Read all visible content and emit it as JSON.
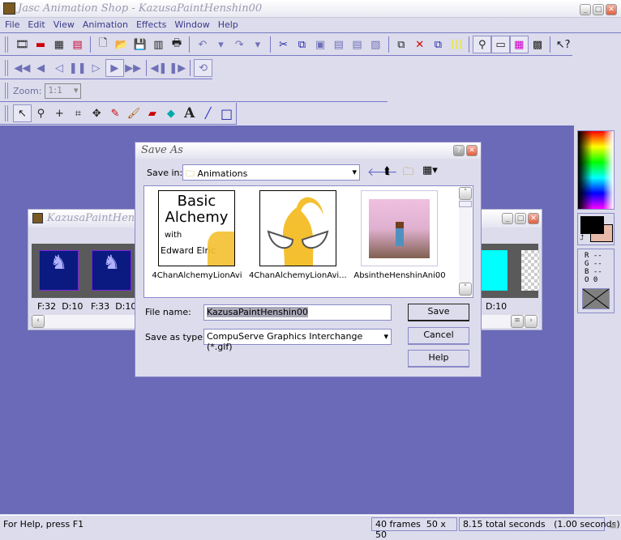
{
  "app": {
    "title": "Jasc Animation Shop - KazusaPaintHenshin00"
  },
  "menu": [
    "File",
    "Edit",
    "View",
    "Animation",
    "Effects",
    "Window",
    "Help"
  ],
  "toolbar": {
    "zoom_label": "Zoom:",
    "zoom_value": "1:1"
  },
  "icons": {
    "standard": [
      "animation-wizard-icon",
      "banner-wizard-icon",
      "optimization-wizard-icon",
      "export-icon",
      "new-icon",
      "open-icon",
      "save-icon",
      "save-frames-icon",
      "print-icon",
      "undo-icon",
      "undo-dropdown-icon",
      "redo-icon",
      "redo-dropdown-icon",
      "cut-icon",
      "copy-icon",
      "paste-new-icon",
      "paste-after-icon",
      "paste-before-icon",
      "paste-into-icon",
      "duplicate-icon",
      "delete-frames-icon",
      "copy-frames-icon",
      "transitions-icon",
      "preview-icon",
      "properties-icon",
      "palette-icon",
      "film-strip-icon",
      "context-help-icon"
    ],
    "vcr": [
      "first-frame-icon",
      "prev-frame-icon",
      "prev-icon",
      "pause-icon",
      "next-icon",
      "play-icon",
      "last-frame-icon",
      "step-back-icon",
      "step-forward-icon",
      "loop-icon"
    ],
    "tools": [
      "arrow-tool-icon",
      "zoom-tool-icon",
      "crosshair-tool-icon",
      "crop-tool-icon",
      "move-tool-icon",
      "dropper-tool-icon",
      "brush-tool-icon",
      "eraser-tool-icon",
      "fill-tool-icon",
      "text-tool-icon",
      "line-tool-icon",
      "rectangle-tool-icon"
    ]
  },
  "child_window": {
    "title": "KazusaPaintHenshin00",
    "frames": [
      {
        "label": "F:32",
        "delay": "D:10"
      },
      {
        "label": "F:33",
        "delay": "D:10"
      }
    ],
    "right_delay": "D:10"
  },
  "dialog": {
    "title": "Save As",
    "save_in_label": "Save in:",
    "save_in_value": "Animations",
    "files": [
      {
        "name": "4ChanAlchemyLionAvi",
        "thumb_lines": [
          "Basic",
          "Alchemy",
          "with",
          "Edward Elric"
        ]
      },
      {
        "name": "4ChanAlchemyLionAvi..."
      },
      {
        "name": "AbsintheHenshinAni00"
      }
    ],
    "file_name_label": "File name:",
    "file_name_value": "KazusaPaintHenshin00",
    "type_label": "Save as type:",
    "type_value": "CompuServe Graphics Interchange (*.gif)",
    "buttons": {
      "save": "Save",
      "cancel": "Cancel",
      "help": "Help"
    }
  },
  "palette": {
    "foreground": "#000000",
    "background": "#e8b8a8",
    "r": "R --",
    "g": "G --",
    "b": "B --",
    "o": "O 0"
  },
  "status": {
    "help": "For Help, press F1",
    "frames": "40 frames",
    "size": "50 x 50",
    "time": "8.15 total seconds   (1.00 seconds)"
  },
  "colors": {
    "workspace": "#6a6ab8",
    "chrome": "#dcdcec",
    "accent": "#7a7ac8"
  }
}
